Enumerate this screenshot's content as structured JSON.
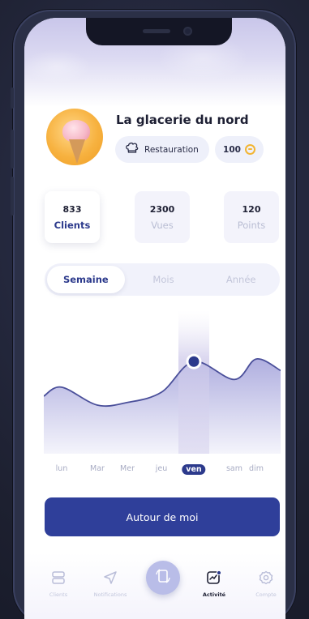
{
  "profile": {
    "name": "La glacerie du nord",
    "category_label": "Restauration",
    "category_icon": "chef-hat-icon",
    "points_value": "100",
    "points_icon": "coin-icon"
  },
  "stats": [
    {
      "value": "833",
      "label": "Clients",
      "active": true
    },
    {
      "value": "2300",
      "label": "Vues",
      "active": false
    },
    {
      "value": "120",
      "label": "Points",
      "active": false
    }
  ],
  "period_tabs": {
    "items": [
      "Semaine",
      "Mois",
      "Année"
    ],
    "selected": "Semaine"
  },
  "chart_data": {
    "type": "area",
    "categories": [
      "lun",
      "Mar",
      "Mer",
      "jeu",
      "ven",
      "sam",
      "dim"
    ],
    "values": [
      0.52,
      0.38,
      0.4,
      0.48,
      0.72,
      0.58,
      0.74
    ],
    "highlight": "ven",
    "colors": {
      "line": "#4a4f9a",
      "fill_top": "#a7a6dc",
      "fill_bottom": "#f3f3fb",
      "highlight": "#d8d4ee",
      "marker": "#2c3a8c"
    }
  },
  "cta": {
    "label": "Autour de moi"
  },
  "tabbar": {
    "items": [
      {
        "label": "Clients",
        "icon": "cards-stack-icon"
      },
      {
        "label": "Notifications",
        "icon": "send-arrow-icon"
      },
      {
        "label": "",
        "icon": "rotate-device-icon"
      },
      {
        "label": "Activité",
        "icon": "activity-chart-icon"
      },
      {
        "label": "Compte",
        "icon": "gear-icon"
      }
    ],
    "selected": "Activité"
  }
}
